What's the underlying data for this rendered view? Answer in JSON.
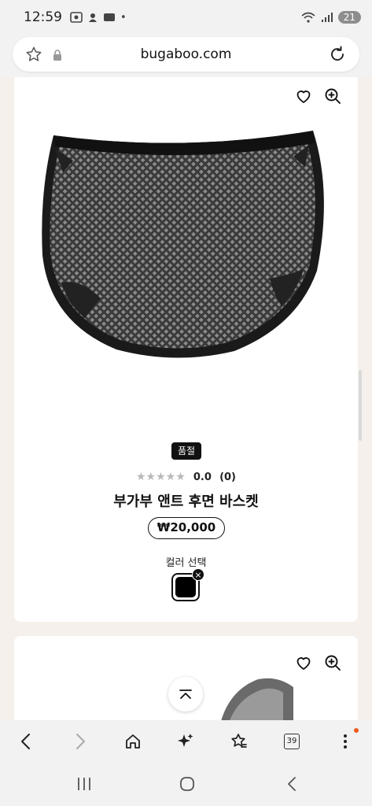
{
  "status_bar": {
    "time": "12:59",
    "battery": "21"
  },
  "browser": {
    "url": "bugaboo.com",
    "tab_count": "39"
  },
  "product": {
    "badge": "품절",
    "stars": "★★★★★",
    "rating": "0.0",
    "review_count": "(0)",
    "title": "부가부 앤트 후면 바스켓",
    "price": "₩20,000",
    "color_label": "컬러 선택",
    "swatch_close": "×"
  },
  "icons": [
    "star-icon",
    "lock-icon",
    "reload-icon",
    "heart-icon",
    "zoom-in-icon",
    "chevron-up-icon",
    "back-icon",
    "forward-icon",
    "home-icon",
    "sparkle-icon",
    "bookmarks-icon",
    "tabs-icon",
    "more-icon"
  ]
}
